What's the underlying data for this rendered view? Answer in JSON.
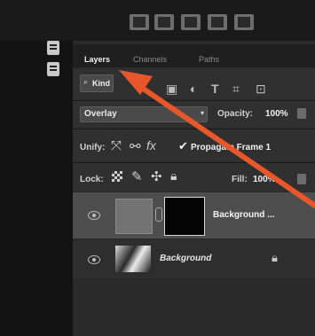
{
  "panel": {
    "tabs": [
      {
        "label": "Layers",
        "active": true
      },
      {
        "label": "Channels",
        "active": false
      },
      {
        "label": "Paths",
        "active": false
      }
    ],
    "filter": {
      "label": "Kind",
      "icons": [
        "image-filter-icon",
        "adjustment-filter-icon",
        "type-filter-icon",
        "shape-filter-icon",
        "smart-object-filter-icon"
      ]
    },
    "blend_mode": {
      "value": "Overlay"
    },
    "opacity": {
      "label": "Opacity:",
      "value": "100%"
    },
    "unify": {
      "label": "Unify:",
      "propagate_label": "Propagate Frame 1",
      "propagate_checked": true
    },
    "lock": {
      "label": "Lock:"
    },
    "fill": {
      "label": "Fill:",
      "value": "100%"
    },
    "layers": [
      {
        "name": "Background ...",
        "selected": true,
        "visible": true
      },
      {
        "name": "Background",
        "selected": false,
        "visible": true,
        "locked": true
      }
    ]
  },
  "colors": {
    "arrow": "#e8572a",
    "panel": "#2a2a2a",
    "selected_row": "#4e4e4e"
  }
}
